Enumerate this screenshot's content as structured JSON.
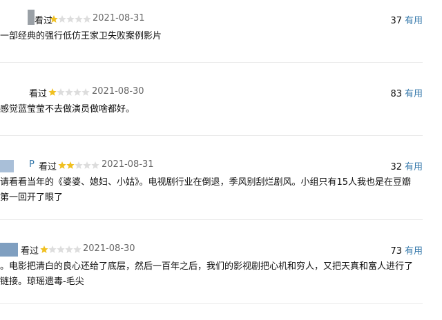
{
  "reviews": [
    {
      "user_label": "看过",
      "rating": 1,
      "date": "2021-08-31",
      "votes": "37",
      "useful_label": "有用",
      "content": "一部经典的强行低仿王家卫失败案例影片"
    },
    {
      "user_label": "看过",
      "rating": 1,
      "date": "2021-08-30",
      "votes": "83",
      "useful_label": "有用",
      "content": "感觉蓝莹莹不去做演员做啥都好。"
    },
    {
      "user_prefix": "P",
      "user_label": "看过",
      "rating": 2,
      "date": "2021-08-31",
      "votes": "32",
      "useful_label": "有用",
      "content_line1": "请看看当年的《婆婆、媳妇、小姑》。电视剧行业在倒退，季风别刮烂剧风。小组只有15人我也是在豆瓣",
      "content_line2": "第一回开了眼了"
    },
    {
      "user_label": "看过",
      "rating": 1,
      "date": "2021-08-30",
      "votes": "73",
      "useful_label": "有用",
      "content_line1": "。电影把清白的良心还给了底层，然后一百年之后，我们的影视剧把心机和穷人，又把天真和富人进行了",
      "content_line2": "链接。琼瑶遗毒-毛尖"
    }
  ],
  "colors": {
    "link": "#3377aa",
    "star_on": "#f0c020",
    "star_off": "#dddddd",
    "divider": "#eaeaea"
  }
}
